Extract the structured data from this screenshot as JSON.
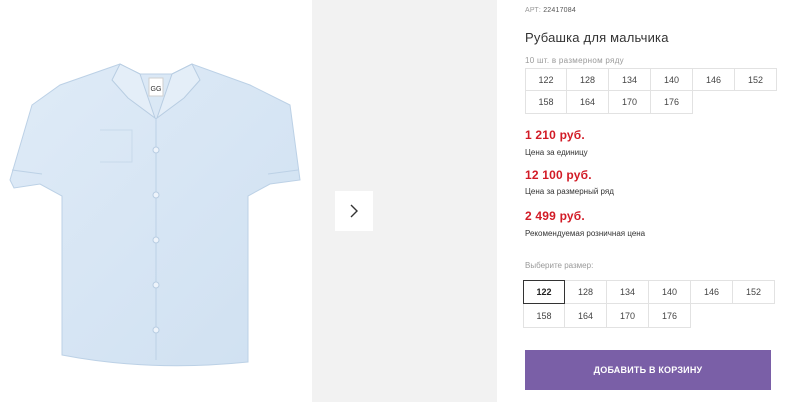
{
  "product": {
    "article_label": "АРТ:",
    "article_number": "22417084",
    "title": "Рубашка для мальчика"
  },
  "pack": {
    "label": "10 шт. в размерном ряду",
    "sizes": [
      "122",
      "128",
      "134",
      "140",
      "146",
      "152",
      "158",
      "164",
      "170",
      "176"
    ]
  },
  "prices": {
    "unit_price": "1 210 руб.",
    "unit_caption": "Цена за единицу",
    "row_price": "12 100 руб.",
    "row_caption": "Цена за размерный ряд",
    "retail_price": "2 499 руб.",
    "retail_caption": "Рекомендуемая розничная цена"
  },
  "size_select": {
    "label": "Выберите размер:",
    "selected": "122",
    "sizes": [
      "122",
      "128",
      "134",
      "140",
      "146",
      "152",
      "158",
      "164",
      "170",
      "176"
    ]
  },
  "cart": {
    "button_label": "ДОБАВИТЬ В КОРЗИНУ"
  },
  "gallery": {
    "next_icon": "chevron-right-icon",
    "brand_tag_text": "GG"
  },
  "colors": {
    "price": "#d21b26",
    "accent": "#7a5fa7",
    "shirt": "#d7e6f4"
  }
}
